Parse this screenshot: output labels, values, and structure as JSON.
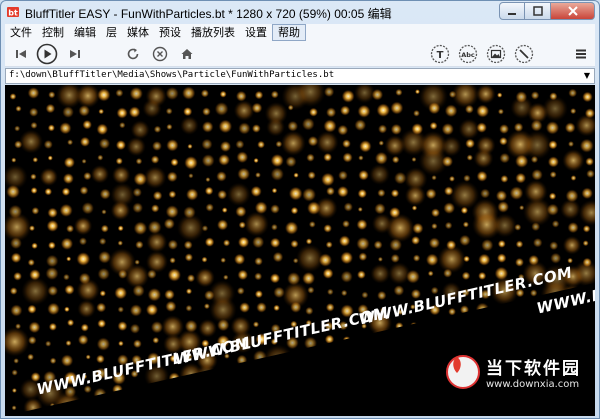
{
  "window": {
    "title": "BluffTitler EASY  - FunWithParticles.bt * 1280 x 720 (59%) 00:05 编辑"
  },
  "menu": {
    "items": [
      {
        "label": "文件",
        "active": false
      },
      {
        "label": "控制",
        "active": false
      },
      {
        "label": "编辑",
        "active": false
      },
      {
        "label": "层",
        "active": false
      },
      {
        "label": "媒体",
        "active": false
      },
      {
        "label": "预设",
        "active": false
      },
      {
        "label": "播放列表",
        "active": false
      },
      {
        "label": "设置",
        "active": false
      },
      {
        "label": "帮助",
        "active": true
      }
    ]
  },
  "toolbar": {
    "text_icon_label": "T",
    "abc_icon_label": "Abc"
  },
  "pathbar": {
    "value": "f:\\down\\BluffTitler\\Media\\Shows\\Particle\\FunWithParticles.bt"
  },
  "viewport": {
    "band_texts": [
      "WWW.BLUFFTITLER.COM",
      "WWW.BLUFFTITLER.COM",
      "WWW.BLUFFTITLER.COM",
      "WWW.BLUFFTITLER.COM",
      "WWW.BL"
    ],
    "particle_color": "#ffb830"
  },
  "watermark": {
    "name": "当下软件园",
    "url": "www.downxia.com"
  }
}
